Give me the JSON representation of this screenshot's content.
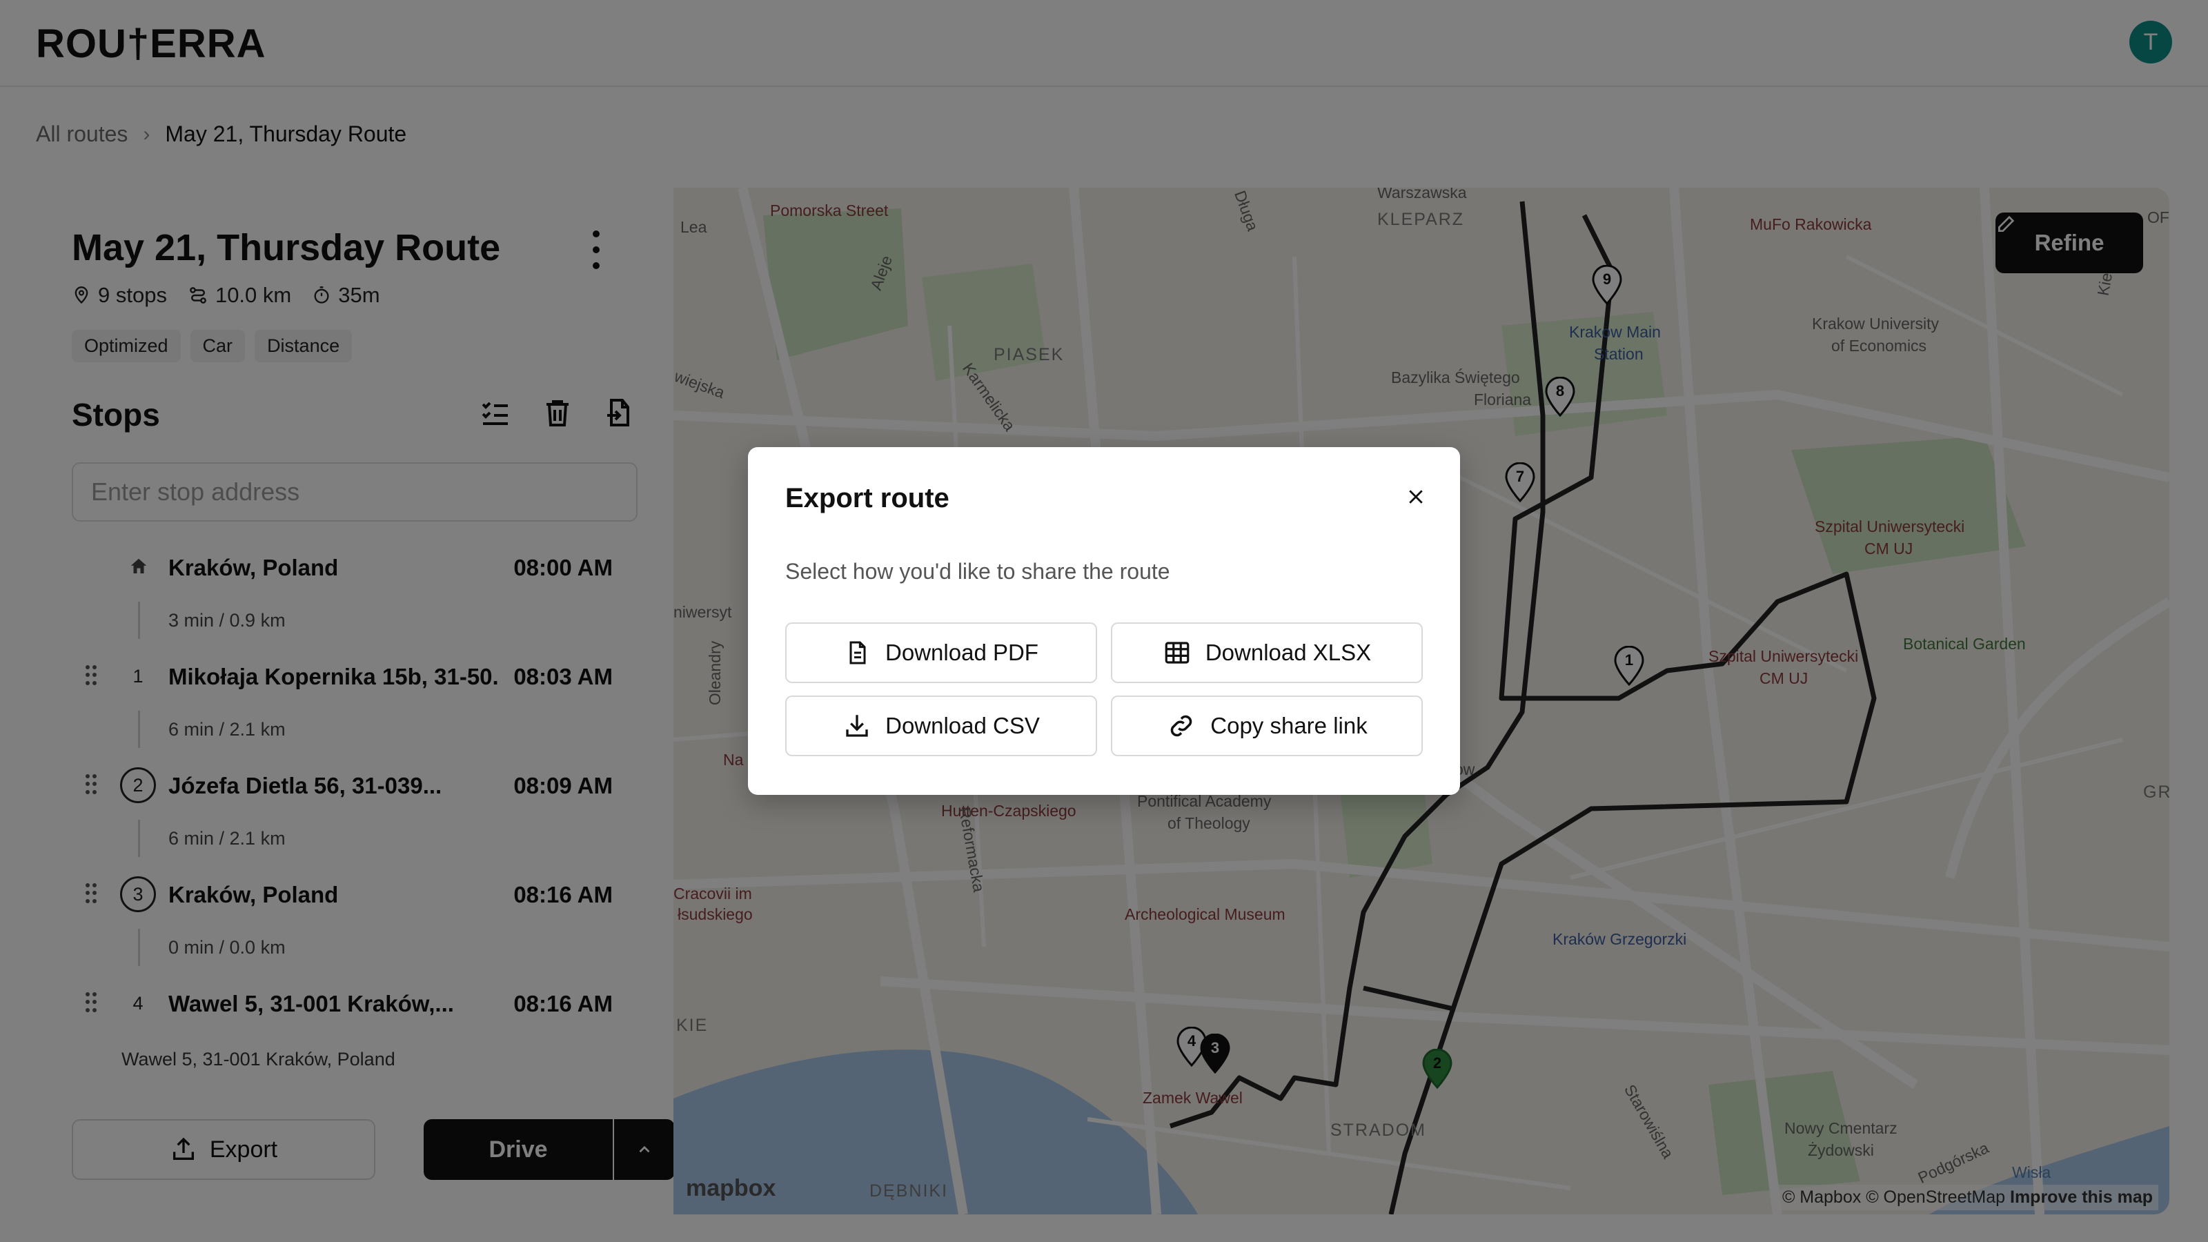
{
  "app": {
    "logo": "ROU†ERRA",
    "avatar_initial": "T"
  },
  "breadcrumb": {
    "parent": "All routes",
    "separator": "›",
    "current": "May 21, Thursday Route"
  },
  "route": {
    "title": "May 21, Thursday Route",
    "stops_count": "9 stops",
    "distance": "10.0 km",
    "duration": "35m",
    "tags": [
      "Optimized",
      "Car",
      "Distance"
    ]
  },
  "stops_panel": {
    "title": "Stops",
    "input_placeholder": "Enter stop address",
    "stops": [
      {
        "number": "",
        "address": "Kraków, Poland",
        "time": "08:00 AM",
        "leg": "3 min / 0.9 km"
      },
      {
        "number": "1",
        "address": "Mikołaja Kopernika 15b, 31-50...",
        "time": "08:03 AM",
        "leg": "6 min / 2.1 km"
      },
      {
        "number": "2",
        "address": "Józefa Dietla 56, 31-039...",
        "time": "08:09 AM",
        "leg": "6 min / 2.1 km"
      },
      {
        "number": "3",
        "address": "Kraków, Poland",
        "time": "08:16 AM",
        "leg": "0 min / 0.0 km"
      },
      {
        "number": "4",
        "address": "Wawel 5, 31-001 Kraków,...",
        "time": "08:16 AM",
        "leg": ""
      }
    ],
    "last_sub": "Wawel 5, 31-001 Kraków, Poland",
    "export_label": "Export",
    "drive_label": "Drive"
  },
  "map": {
    "refine_label": "Refine",
    "mapbox_logo": "mapbox",
    "attribution": "© Mapbox © OpenStreetMap",
    "improve": "Improve this map",
    "labels": {
      "pomorska": "Pomorska Street",
      "kleparz": "KLEPARZ",
      "warszawska": "Warszawska",
      "mufo": "MuFo Rakowicka",
      "piasek": "PIASEK",
      "bazylika1": "Bazylika Świętego",
      "bazylika2": "Floriana",
      "main_station1": "Krakow Main",
      "main_station2": "Station",
      "economics1": "Krakow University",
      "economics2": "of Economics",
      "szpital_a1": "Szpital Uniwersytecki",
      "szpital_a2": "CM UJ",
      "szpital_b1": "Szpital Uniwersytecki",
      "szpital_b2": "CM UJ",
      "botanical": "Botanical Garden",
      "pontifical1": "Pontifical Academy",
      "pontifical2": "of Theology",
      "hutten": "Hutten-Czapskiego",
      "archeo": "Archeological Museum",
      "grzegorzki": "Kraków Grzegorzki",
      "zamek": "Zamek Wawel",
      "stradom": "STRADOM",
      "debniki": "DĘBNIKI",
      "cmentarz1": "Nowy Cmentarz",
      "cmentarz2": "Żydowski",
      "lea": "Lea",
      "aleje": "Aleje",
      "karmelicka": "Karmelicka",
      "dluga": "Długa",
      "starowislna": "Starowiślna",
      "podgorska": "Podgórska",
      "kielecka": "Kielecka",
      "reformacka": "Reformacka",
      "krakow": "rakow",
      "kie": "KIE",
      "gr": "GR",
      "wisla": "Wisła",
      "cracovii1": "Cracovii im",
      "cracovii2": "łsudskiego",
      "niwerst": "niwersyt",
      "wiejska": "wiejska",
      "olean": "Oleandry",
      "na": "Na",
      "of": "OF"
    },
    "pins": [
      "9",
      "8",
      "7",
      "1",
      "4",
      "3",
      "2"
    ]
  },
  "modal": {
    "title": "Export route",
    "description": "Select how you'd like to share the route",
    "options": {
      "pdf": "Download PDF",
      "xlsx": "Download XLSX",
      "csv": "Download CSV",
      "share": "Copy share link"
    }
  },
  "colors": {
    "accent": "#111111",
    "avatar": "#0e8f86",
    "overlay": "rgba(0,0,0,0.5)",
    "park": "#cfe3c2",
    "water": "#a8c8e8"
  }
}
